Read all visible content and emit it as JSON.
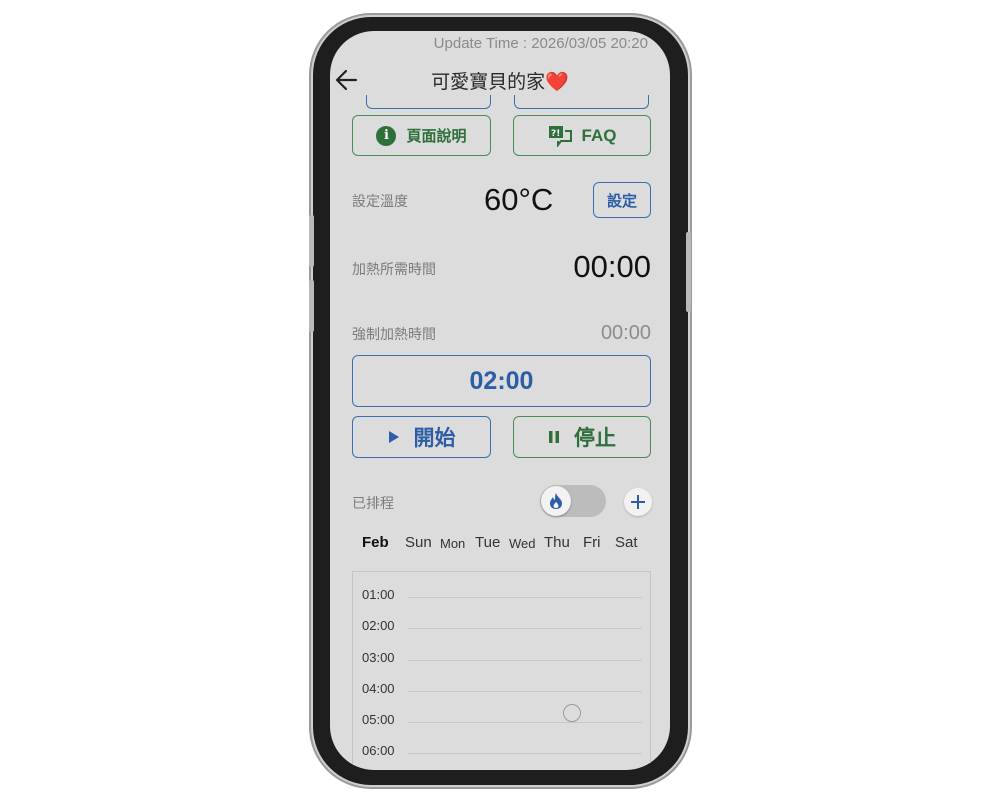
{
  "status_bar": {
    "update_time": "Update Time : 2026/03/05 20:20"
  },
  "header": {
    "title": "可愛寶貝的家",
    "title_emoji": "❤️"
  },
  "buttons": {
    "page_info": "頁面說明",
    "faq": "FAQ",
    "set": "設定",
    "start": "開始",
    "stop": "停止"
  },
  "temperature": {
    "label": "設定溫度",
    "value": "60°C"
  },
  "heating_time": {
    "label": "加熱所需時間",
    "value": "00:00"
  },
  "forced_heating": {
    "label": "強制加熱時間",
    "remaining": "00:00",
    "duration": "02:00"
  },
  "schedule": {
    "label": "已排程",
    "toggle_on": false,
    "month": "Feb",
    "days": [
      "Sun",
      "Mon",
      "Tue",
      "Wed",
      "Thu",
      "Fri",
      "Sat"
    ],
    "times": [
      "01:00",
      "02:00",
      "03:00",
      "04:00",
      "05:00",
      "06:00"
    ]
  },
  "icons": {
    "back": "arrow-left-icon",
    "info": "info-icon",
    "faq": "faq-icon",
    "play": "play-icon",
    "pause": "pause-icon",
    "flame": "flame-icon",
    "add": "plus-icon"
  },
  "colors": {
    "green": "#2e6f3a",
    "blue": "#2c5da6",
    "screen_bg": "#dcdcdc"
  }
}
